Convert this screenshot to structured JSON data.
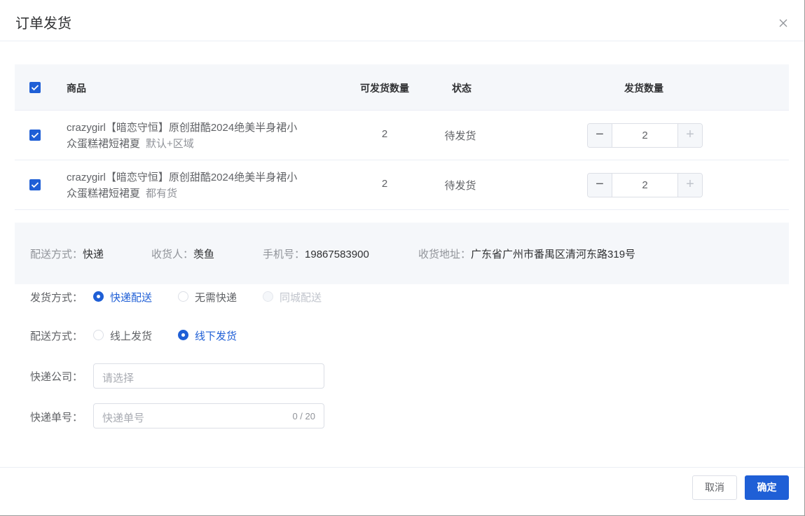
{
  "dialog": {
    "title": "订单发货"
  },
  "table": {
    "headers": {
      "product": "商品",
      "available_qty": "可发货数量",
      "status": "状态",
      "ship_qty": "发货数量"
    },
    "rows": [
      {
        "name": "crazygirl【暗恋守恒】原创甜酷2024绝美半身裙小众蛋糕裙短裙夏",
        "spec": "默认+区域",
        "available_qty": "2",
        "status": "待发货",
        "ship_qty": "2",
        "checked": true
      },
      {
        "name": "crazygirl【暗恋守恒】原创甜酷2024绝美半身裙小众蛋糕裙短裙夏",
        "spec": "都有货",
        "available_qty": "2",
        "status": "待发货",
        "ship_qty": "2",
        "checked": true
      }
    ]
  },
  "info": {
    "delivery_label": "配送方式：",
    "delivery_value": "快递",
    "receiver_label": "收货人：",
    "receiver_value": "羡鱼",
    "phone_label": "手机号：",
    "phone_value": "19867583900",
    "address_label": "收货地址：",
    "address_value": "广东省广州市番禺区清河东路319号"
  },
  "form": {
    "ship_method": {
      "label": "发货方式：",
      "options": [
        "快递配送",
        "无需快递",
        "同城配送"
      ],
      "selected": "快递配送"
    },
    "delivery_method": {
      "label": "配送方式：",
      "options": [
        "线上发货",
        "线下发货"
      ],
      "selected": "线下发货"
    },
    "express_company": {
      "label": "快递公司：",
      "placeholder": "请选择"
    },
    "tracking_no": {
      "label": "快递单号：",
      "placeholder": "快递单号",
      "counter": "0 / 20"
    }
  },
  "footer": {
    "cancel_label": "取消",
    "confirm_label": "确定"
  },
  "colors": {
    "primary": "#1f5fd6",
    "header_bg": "#f5f7fa"
  }
}
